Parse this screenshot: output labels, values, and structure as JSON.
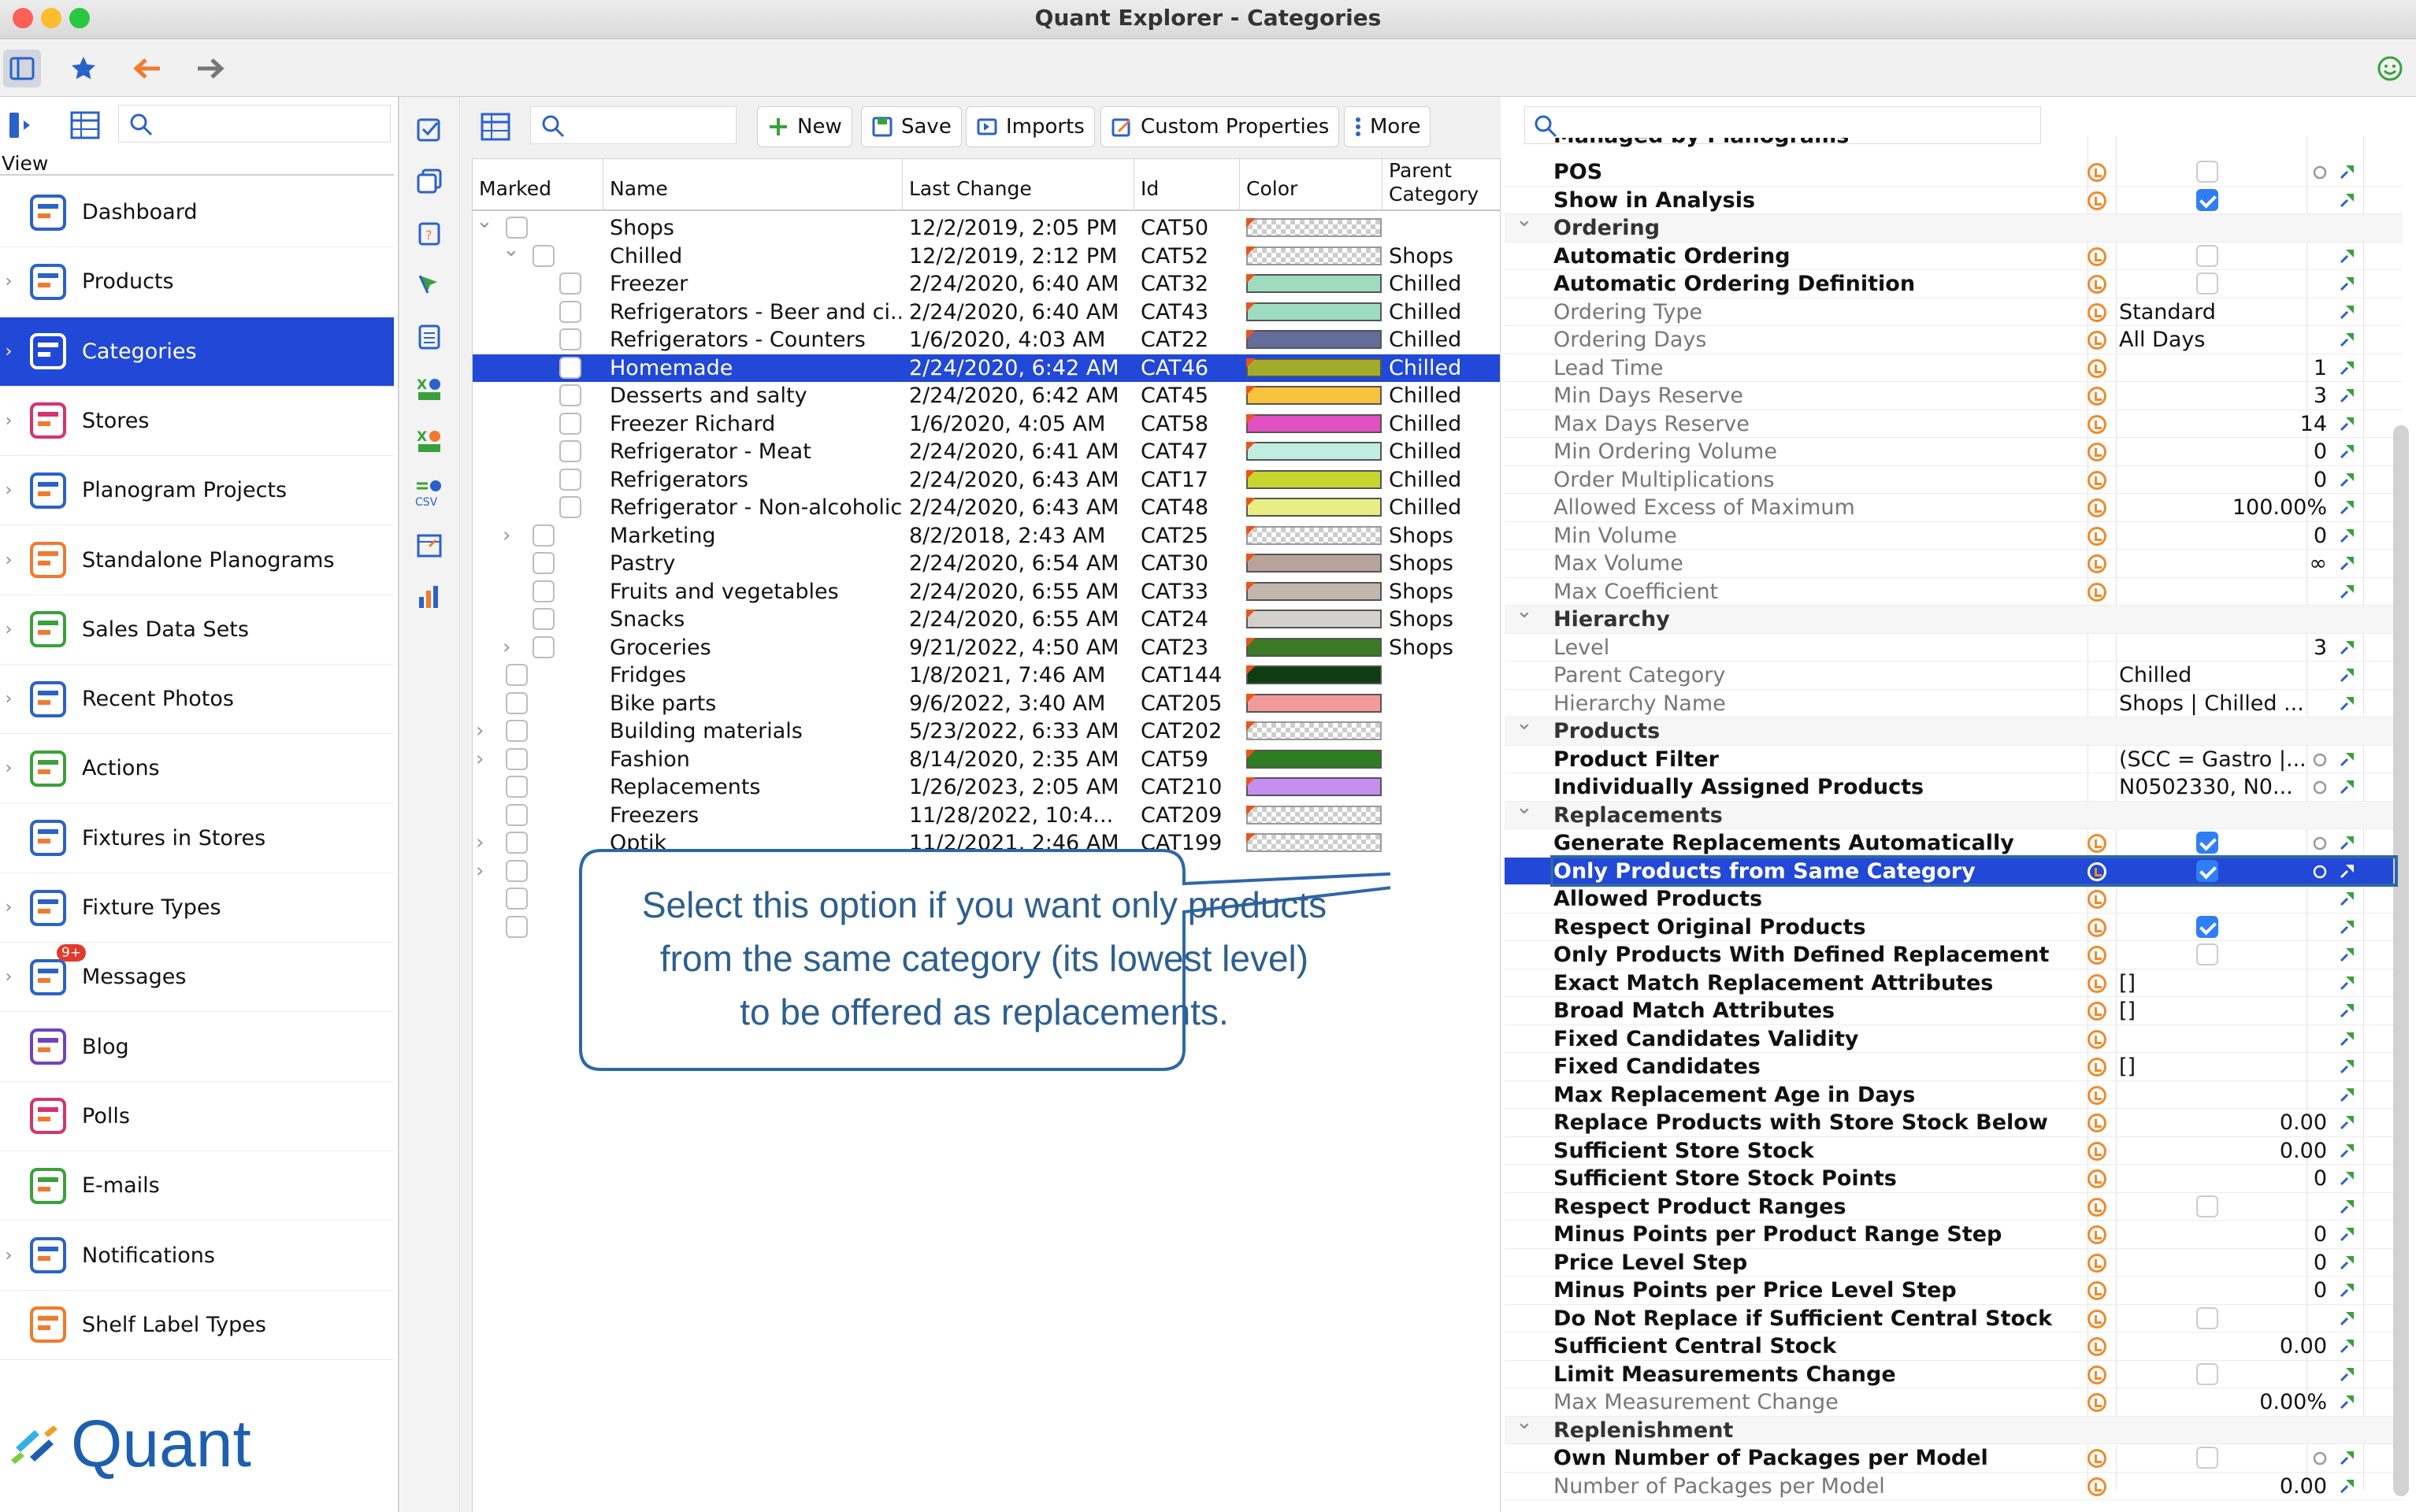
{
  "window": {
    "title": "Quant Explorer - Categories"
  },
  "left": {
    "view_label": "View",
    "nav": [
      {
        "label": "Dashboard",
        "icon": "dashboard-icon",
        "chevron": false
      },
      {
        "label": "Products",
        "icon": "products-icon",
        "chevron": true
      },
      {
        "label": "Categories",
        "icon": "categories-icon",
        "chevron": true,
        "selected": true
      },
      {
        "label": "Stores",
        "icon": "stores-icon",
        "chevron": true
      },
      {
        "label": "Planogram Projects",
        "icon": "planogram-projects-icon",
        "chevron": true
      },
      {
        "label": "Standalone Planograms",
        "icon": "standalone-planograms-icon",
        "chevron": true
      },
      {
        "label": "Sales Data Sets",
        "icon": "sales-data-icon",
        "chevron": true
      },
      {
        "label": "Recent Photos",
        "icon": "camera-icon",
        "chevron": true
      },
      {
        "label": "Actions",
        "icon": "actions-icon",
        "chevron": true
      },
      {
        "label": "Fixtures in Stores",
        "icon": "fixtures-icon",
        "chevron": false
      },
      {
        "label": "Fixture Types",
        "icon": "fixture-types-icon",
        "chevron": true
      },
      {
        "label": "Messages",
        "icon": "messages-icon",
        "chevron": true,
        "badge": "9+"
      },
      {
        "label": "Blog",
        "icon": "blog-icon",
        "chevron": false
      },
      {
        "label": "Polls",
        "icon": "polls-icon",
        "chevron": false
      },
      {
        "label": "E-mails",
        "icon": "email-icon",
        "chevron": false
      },
      {
        "label": "Notifications",
        "icon": "bell-icon",
        "chevron": true
      },
      {
        "label": "Shelf Label Types",
        "icon": "shelf-label-icon",
        "chevron": false
      }
    ],
    "logo_text": "Quant"
  },
  "center": {
    "toolbar": {
      "new": "New",
      "save": "Save",
      "imports": "Imports",
      "custom": "Custom Properties",
      "more": "More"
    },
    "columns": {
      "marked": "Marked",
      "name": "Name",
      "last_change": "Last Change",
      "id": "Id",
      "color": "Color",
      "parent": "Parent Category"
    },
    "rows": [
      {
        "name": "Shops",
        "date": "12/2/2019, 2:05 PM",
        "id": "CAT50",
        "color": "",
        "parent": "",
        "level": 0,
        "exp": "down"
      },
      {
        "name": "Chilled",
        "date": "12/2/2019, 2:12 PM",
        "id": "CAT52",
        "color": "",
        "parent": "Shops",
        "level": 1,
        "exp": "down"
      },
      {
        "name": "Freezer",
        "date": "2/24/2020, 6:40 AM",
        "id": "CAT32",
        "color": "#9fdcbf",
        "parent": "Chilled",
        "level": 2
      },
      {
        "name": "Refrigerators - Beer and ci...",
        "date": "2/24/2020, 6:40 AM",
        "id": "CAT43",
        "color": "#9fdcbf",
        "parent": "Chilled",
        "level": 2
      },
      {
        "name": "Refrigerators - Counters",
        "date": "1/6/2020, 4:03 AM",
        "id": "CAT22",
        "color": "#646c9a",
        "parent": "Chilled",
        "level": 2
      },
      {
        "name": "Homemade",
        "date": "2/24/2020, 6:42 AM",
        "id": "CAT46",
        "color": "#a2ab2a",
        "parent": "Chilled",
        "level": 2,
        "selected": true
      },
      {
        "name": "Desserts and salty",
        "date": "2/24/2020, 6:42 AM",
        "id": "CAT45",
        "color": "#f7c23c",
        "parent": "Chilled",
        "level": 2
      },
      {
        "name": "Freezer Richard",
        "date": "1/6/2020, 4:05 AM",
        "id": "CAT58",
        "color": "#e24fc0",
        "parent": "Chilled",
        "level": 2
      },
      {
        "name": "Refrigerator - Meat",
        "date": "2/24/2020, 6:41 AM",
        "id": "CAT47",
        "color": "#bfeee0",
        "parent": "Chilled",
        "level": 2
      },
      {
        "name": "Refrigerators",
        "date": "2/24/2020, 6:43 AM",
        "id": "CAT17",
        "color": "#c7d62f",
        "parent": "Chilled",
        "level": 2
      },
      {
        "name": "Refrigerator - Non-alcoholic",
        "date": "2/24/2020, 6:43 AM",
        "id": "CAT48",
        "color": "#e8ee84",
        "parent": "Chilled",
        "level": 2
      },
      {
        "name": "Marketing",
        "date": "8/2/2018, 2:43 AM",
        "id": "CAT25",
        "color": "",
        "parent": "Shops",
        "level": 1,
        "exp": "right"
      },
      {
        "name": "Pastry",
        "date": "2/24/2020, 6:54 AM",
        "id": "CAT30",
        "color": "#b8a39b",
        "parent": "Shops",
        "level": 1
      },
      {
        "name": "Fruits and vegetables",
        "date": "2/24/2020, 6:55 AM",
        "id": "CAT33",
        "color": "#c2b6ad",
        "parent": "Shops",
        "level": 1
      },
      {
        "name": "Snacks",
        "date": "2/24/2020, 6:55 AM",
        "id": "CAT24",
        "color": "#d4d1cc",
        "parent": "Shops",
        "level": 1
      },
      {
        "name": "Groceries",
        "date": "9/21/2022, 4:50 AM",
        "id": "CAT23",
        "color": "#3b7a25",
        "parent": "Shops",
        "level": 1,
        "exp": "right"
      },
      {
        "name": "Fridges",
        "date": "1/8/2021, 7:46 AM",
        "id": "CAT144",
        "color": "#0f3d12",
        "parent": "",
        "level": 0
      },
      {
        "name": "Bike parts",
        "date": "9/6/2022, 3:40 AM",
        "id": "CAT205",
        "color": "#f29a99",
        "parent": "",
        "level": 0
      },
      {
        "name": "Building materials",
        "date": "5/23/2022, 6:33 AM",
        "id": "CAT202",
        "color": "",
        "parent": "",
        "level": 0,
        "exp": "right"
      },
      {
        "name": "Fashion",
        "date": "8/14/2020, 2:35 AM",
        "id": "CAT59",
        "color": "#2f7d22",
        "parent": "",
        "level": 0,
        "exp": "right"
      },
      {
        "name": "Replacements",
        "date": "1/26/2023, 2:05 AM",
        "id": "CAT210",
        "color": "#c68ef0",
        "parent": "",
        "level": 0
      },
      {
        "name": "Freezers",
        "date": "11/28/2022, 10:4...",
        "id": "CAT209",
        "color": "",
        "parent": "",
        "level": 0
      },
      {
        "name": "Optik",
        "date": "11/2/2021, 2:46 AM",
        "id": "CAT199",
        "color": "",
        "parent": "",
        "level": 0,
        "exp": "right"
      }
    ]
  },
  "callout": {
    "line1": "Select this option if you want only products",
    "line2": "from the same category (its lowest level)",
    "line3": "to be offered as replacements."
  },
  "props": {
    "partial_top": "Managed by Planograms",
    "rows": [
      {
        "name": "POS",
        "type": "prop",
        "check": false
      },
      {
        "name": "Show in Analysis",
        "type": "prop",
        "check": true
      },
      {
        "name": "Ordering",
        "type": "group"
      },
      {
        "name": "Automatic Ordering",
        "type": "prop",
        "check": false
      },
      {
        "name": "Automatic Ordering Definition",
        "type": "prop",
        "check": false
      },
      {
        "name": "Ordering Type",
        "type": "dis",
        "text": "Standard"
      },
      {
        "name": "Ordering Days",
        "type": "dis",
        "text": "All Days"
      },
      {
        "name": "Lead Time",
        "type": "dis",
        "num": "1"
      },
      {
        "name": "Min Days Reserve",
        "type": "dis",
        "num": "3"
      },
      {
        "name": "Max Days Reserve",
        "type": "dis",
        "num": "14"
      },
      {
        "name": "Min Ordering Volume",
        "type": "dis",
        "num": "0"
      },
      {
        "name": "Order Multiplications",
        "type": "dis",
        "num": "0"
      },
      {
        "name": "Allowed Excess of Maximum",
        "type": "dis",
        "num": "100.00%"
      },
      {
        "name": "Min Volume",
        "type": "dis",
        "num": "0"
      },
      {
        "name": "Max Volume",
        "type": "dis",
        "num": "∞"
      },
      {
        "name": "Max Coefficient",
        "type": "dis"
      },
      {
        "name": "Hierarchy",
        "type": "group"
      },
      {
        "name": "Level",
        "type": "dis",
        "num": "3",
        "noicon": true
      },
      {
        "name": "Parent Category",
        "type": "dis",
        "text": "Chilled",
        "noicon": true
      },
      {
        "name": "Hierarchy Name",
        "type": "dis",
        "text": "Shops | Chilled ...",
        "noicon": true
      },
      {
        "name": "Products",
        "type": "group"
      },
      {
        "name": "Product Filter",
        "type": "prop",
        "text": "(SCC = Gastro |...",
        "noicon": true
      },
      {
        "name": "Individually Assigned Products",
        "type": "prop",
        "text": "N0502330, N0...",
        "noicon": true
      },
      {
        "name": "Replacements",
        "type": "group"
      },
      {
        "name": "Generate Replacements Automatically",
        "type": "prop",
        "check": true
      },
      {
        "name": "Only Products from Same Category",
        "type": "prop",
        "check": true,
        "selected": true
      },
      {
        "name": "Allowed Products",
        "type": "prop"
      },
      {
        "name": "Respect Original Products",
        "type": "prop",
        "check": true
      },
      {
        "name": "Only Products With Defined Replacement",
        "type": "prop",
        "check": false
      },
      {
        "name": "Exact Match Replacement Attributes",
        "type": "prop",
        "text": "[]"
      },
      {
        "name": "Broad Match Attributes",
        "type": "prop",
        "text": "[]"
      },
      {
        "name": "Fixed Candidates Validity",
        "type": "prop"
      },
      {
        "name": "Fixed Candidates",
        "type": "prop",
        "text": "[]"
      },
      {
        "name": "Max Replacement Age in Days",
        "type": "prop"
      },
      {
        "name": "Replace Products with Store Stock Below",
        "type": "prop",
        "num": "0.00"
      },
      {
        "name": "Sufficient Store Stock",
        "type": "prop",
        "num": "0.00"
      },
      {
        "name": "Sufficient Store Stock Points",
        "type": "prop",
        "num": "0"
      },
      {
        "name": "Respect Product Ranges",
        "type": "prop",
        "check": false
      },
      {
        "name": "Minus Points per Product Range Step",
        "type": "prop",
        "num": "0"
      },
      {
        "name": "Price Level Step",
        "type": "prop",
        "num": "0"
      },
      {
        "name": "Minus Points per Price Level Step",
        "type": "prop",
        "num": "0"
      },
      {
        "name": "Do Not Replace if Sufficient Central Stock",
        "type": "prop",
        "check": false
      },
      {
        "name": "Sufficient Central Stock",
        "type": "prop",
        "num": "0.00"
      },
      {
        "name": "Limit Measurements Change",
        "type": "prop",
        "check": false
      },
      {
        "name": "Max Measurement Change",
        "type": "dis",
        "num": "0.00%"
      },
      {
        "name": "Replenishment",
        "type": "group"
      },
      {
        "name": "Own Number of Packages per Model",
        "type": "prop",
        "check": false
      },
      {
        "name": "Number of Packages per Model",
        "type": "dis",
        "num": "0.00"
      }
    ]
  },
  "colors": {
    "accent": "#2148d6",
    "callout_text": "#2d5f8f",
    "callout_border": "#2e67a8"
  }
}
